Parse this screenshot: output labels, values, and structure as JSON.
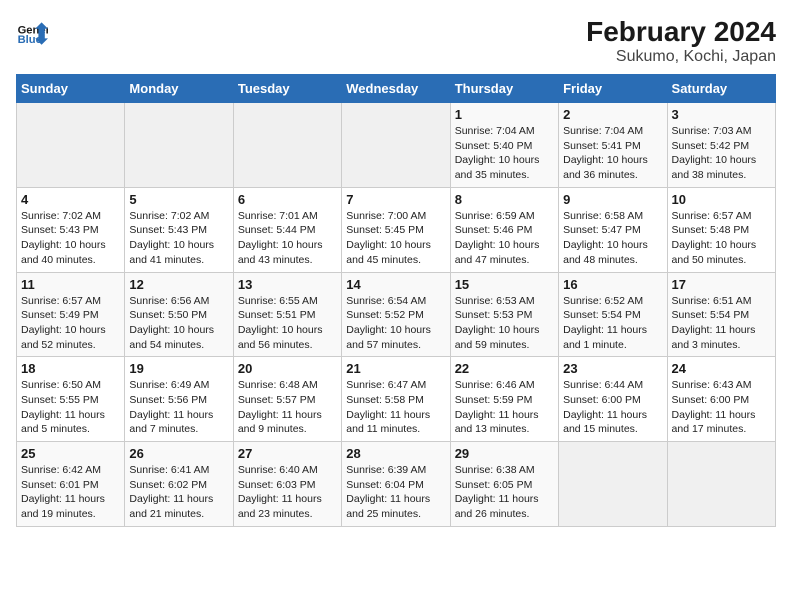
{
  "header": {
    "logo_line1": "General",
    "logo_line2": "Blue",
    "title": "February 2024",
    "subtitle": "Sukumo, Kochi, Japan"
  },
  "weekdays": [
    "Sunday",
    "Monday",
    "Tuesday",
    "Wednesday",
    "Thursday",
    "Friday",
    "Saturday"
  ],
  "weeks": [
    [
      {
        "day": "",
        "info": ""
      },
      {
        "day": "",
        "info": ""
      },
      {
        "day": "",
        "info": ""
      },
      {
        "day": "",
        "info": ""
      },
      {
        "day": "1",
        "info": "Sunrise: 7:04 AM\nSunset: 5:40 PM\nDaylight: 10 hours\nand 35 minutes."
      },
      {
        "day": "2",
        "info": "Sunrise: 7:04 AM\nSunset: 5:41 PM\nDaylight: 10 hours\nand 36 minutes."
      },
      {
        "day": "3",
        "info": "Sunrise: 7:03 AM\nSunset: 5:42 PM\nDaylight: 10 hours\nand 38 minutes."
      }
    ],
    [
      {
        "day": "4",
        "info": "Sunrise: 7:02 AM\nSunset: 5:43 PM\nDaylight: 10 hours\nand 40 minutes."
      },
      {
        "day": "5",
        "info": "Sunrise: 7:02 AM\nSunset: 5:43 PM\nDaylight: 10 hours\nand 41 minutes."
      },
      {
        "day": "6",
        "info": "Sunrise: 7:01 AM\nSunset: 5:44 PM\nDaylight: 10 hours\nand 43 minutes."
      },
      {
        "day": "7",
        "info": "Sunrise: 7:00 AM\nSunset: 5:45 PM\nDaylight: 10 hours\nand 45 minutes."
      },
      {
        "day": "8",
        "info": "Sunrise: 6:59 AM\nSunset: 5:46 PM\nDaylight: 10 hours\nand 47 minutes."
      },
      {
        "day": "9",
        "info": "Sunrise: 6:58 AM\nSunset: 5:47 PM\nDaylight: 10 hours\nand 48 minutes."
      },
      {
        "day": "10",
        "info": "Sunrise: 6:57 AM\nSunset: 5:48 PM\nDaylight: 10 hours\nand 50 minutes."
      }
    ],
    [
      {
        "day": "11",
        "info": "Sunrise: 6:57 AM\nSunset: 5:49 PM\nDaylight: 10 hours\nand 52 minutes."
      },
      {
        "day": "12",
        "info": "Sunrise: 6:56 AM\nSunset: 5:50 PM\nDaylight: 10 hours\nand 54 minutes."
      },
      {
        "day": "13",
        "info": "Sunrise: 6:55 AM\nSunset: 5:51 PM\nDaylight: 10 hours\nand 56 minutes."
      },
      {
        "day": "14",
        "info": "Sunrise: 6:54 AM\nSunset: 5:52 PM\nDaylight: 10 hours\nand 57 minutes."
      },
      {
        "day": "15",
        "info": "Sunrise: 6:53 AM\nSunset: 5:53 PM\nDaylight: 10 hours\nand 59 minutes."
      },
      {
        "day": "16",
        "info": "Sunrise: 6:52 AM\nSunset: 5:54 PM\nDaylight: 11 hours\nand 1 minute."
      },
      {
        "day": "17",
        "info": "Sunrise: 6:51 AM\nSunset: 5:54 PM\nDaylight: 11 hours\nand 3 minutes."
      }
    ],
    [
      {
        "day": "18",
        "info": "Sunrise: 6:50 AM\nSunset: 5:55 PM\nDaylight: 11 hours\nand 5 minutes."
      },
      {
        "day": "19",
        "info": "Sunrise: 6:49 AM\nSunset: 5:56 PM\nDaylight: 11 hours\nand 7 minutes."
      },
      {
        "day": "20",
        "info": "Sunrise: 6:48 AM\nSunset: 5:57 PM\nDaylight: 11 hours\nand 9 minutes."
      },
      {
        "day": "21",
        "info": "Sunrise: 6:47 AM\nSunset: 5:58 PM\nDaylight: 11 hours\nand 11 minutes."
      },
      {
        "day": "22",
        "info": "Sunrise: 6:46 AM\nSunset: 5:59 PM\nDaylight: 11 hours\nand 13 minutes."
      },
      {
        "day": "23",
        "info": "Sunrise: 6:44 AM\nSunset: 6:00 PM\nDaylight: 11 hours\nand 15 minutes."
      },
      {
        "day": "24",
        "info": "Sunrise: 6:43 AM\nSunset: 6:00 PM\nDaylight: 11 hours\nand 17 minutes."
      }
    ],
    [
      {
        "day": "25",
        "info": "Sunrise: 6:42 AM\nSunset: 6:01 PM\nDaylight: 11 hours\nand 19 minutes."
      },
      {
        "day": "26",
        "info": "Sunrise: 6:41 AM\nSunset: 6:02 PM\nDaylight: 11 hours\nand 21 minutes."
      },
      {
        "day": "27",
        "info": "Sunrise: 6:40 AM\nSunset: 6:03 PM\nDaylight: 11 hours\nand 23 minutes."
      },
      {
        "day": "28",
        "info": "Sunrise: 6:39 AM\nSunset: 6:04 PM\nDaylight: 11 hours\nand 25 minutes."
      },
      {
        "day": "29",
        "info": "Sunrise: 6:38 AM\nSunset: 6:05 PM\nDaylight: 11 hours\nand 26 minutes."
      },
      {
        "day": "",
        "info": ""
      },
      {
        "day": "",
        "info": ""
      }
    ]
  ]
}
